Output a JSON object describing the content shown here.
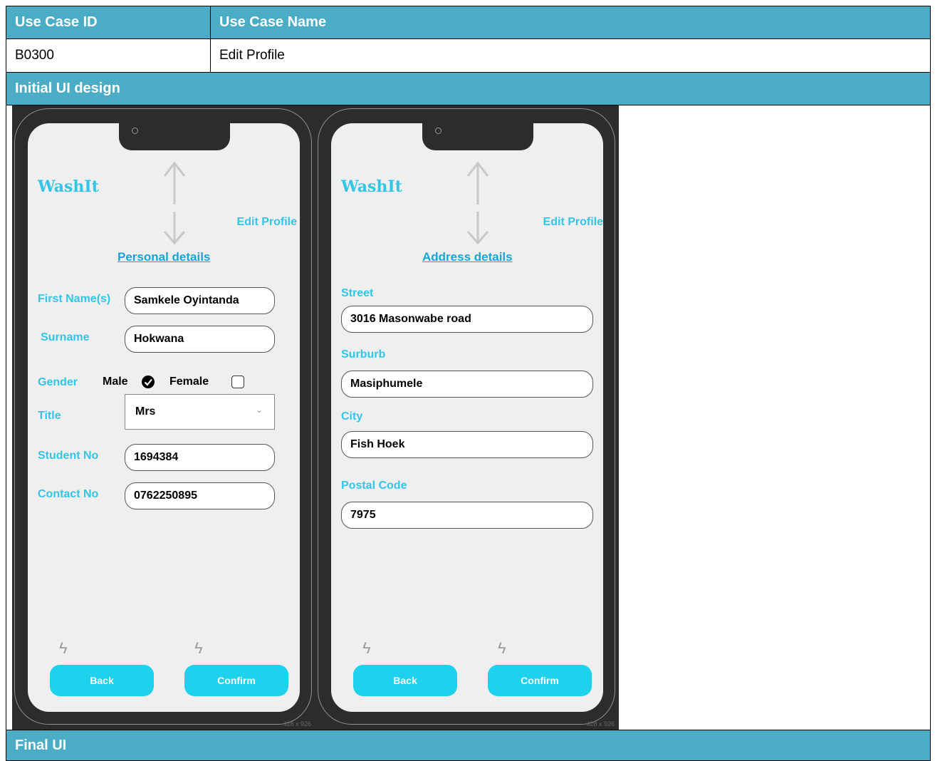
{
  "table": {
    "col1_header": "Use Case ID",
    "col2_header": "Use Case Name",
    "use_case_id": "B0300",
    "use_case_name": "Edit Profile",
    "initial_ui_heading": "Initial UI design",
    "final_ui_heading": "Final UI"
  },
  "colors": {
    "header_bg": "#4bacc6",
    "accent": "#33c5e6",
    "button": "#1ed2ee",
    "frame": "#2c2c2e"
  },
  "mockup_personal": {
    "logo": "WashIt",
    "title": "Edit Profile",
    "section": "Personal details",
    "first_names_label": "First Name(s)",
    "first_names_value": "Samkele Oyintanda",
    "surname_label": "Surname",
    "surname_value": "Hokwana",
    "gender_label": "Gender",
    "male_label": "Male",
    "male_checked": true,
    "female_label": "Female",
    "female_checked": false,
    "title_label": "Title",
    "title_value": "Mrs",
    "student_no_label": "Student No",
    "student_no_value": "1694384",
    "contact_no_label": "Contact No",
    "contact_no_value": "0762250895",
    "back_label": "Back",
    "confirm_label": "Confirm",
    "frame_size": "428 x 926"
  },
  "mockup_address": {
    "logo": "WashIt",
    "title": "Edit Profile",
    "section": "Address details",
    "street_label": "Street",
    "street_value": "3016 Masonwabe road",
    "suburb_label": "Surburb",
    "suburb_value": "Masiphumele",
    "city_label": "City",
    "city_value": "Fish Hoek",
    "postal_label": "Postal Code",
    "postal_value": "7975",
    "back_label": "Back",
    "confirm_label": "Confirm",
    "frame_size": "428 x 926"
  }
}
